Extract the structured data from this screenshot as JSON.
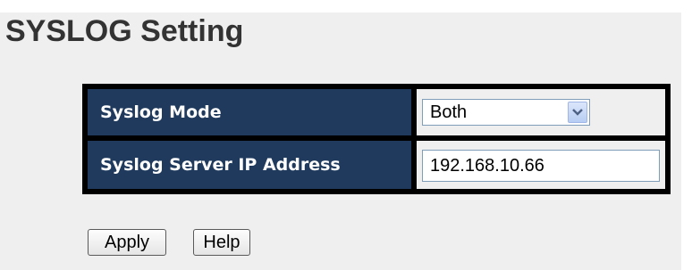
{
  "page": {
    "title": "SYSLOG Setting"
  },
  "settings": {
    "mode_label": "Syslog Mode",
    "mode_value": "Both",
    "server_ip_label": "Syslog Server IP Address",
    "server_ip_value": "192.168.10.66"
  },
  "buttons": {
    "apply_label": "Apply",
    "help_label": "Help"
  },
  "colors": {
    "label_background": "#1f3a5c",
    "panel_background": "#efefef",
    "table_border": "#000000"
  },
  "icons": {
    "dropdown": "chevron-down-icon"
  }
}
